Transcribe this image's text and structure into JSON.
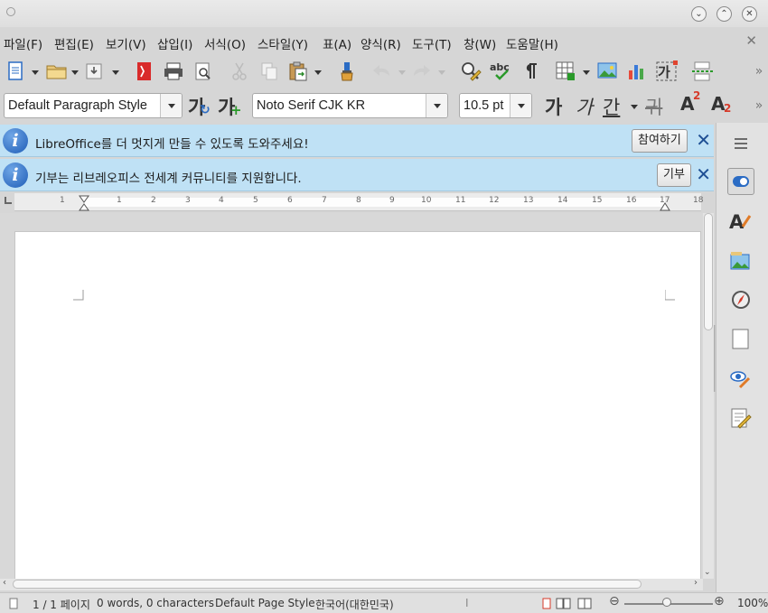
{
  "menubar": {
    "items": [
      "파일(F)",
      "편집(E)",
      "보기(V)",
      "삽입(I)",
      "서식(O)",
      "스타일(Y)",
      "표(A)",
      "양식(R)",
      "도구(T)",
      "창(W)",
      "도움말(H)"
    ]
  },
  "formatting": {
    "paragraph_style": "Default Paragraph Style",
    "font_name": "Noto Serif CJK KR",
    "font_size": "10.5 pt",
    "bold_glyph": "가",
    "italic_glyph": "가",
    "underline_glyph": "간",
    "strike_glyph": "귀",
    "new_style_glyph": "가",
    "update_style_glyph": "가",
    "superscript_glyph": "A",
    "superscript_mark": "2",
    "subscript_glyph": "A",
    "subscript_mark": "2",
    "char_glyph": "가"
  },
  "infobars": [
    {
      "message": "LibreOffice를 더 멋지게 만들 수 있도록 도와주세요!",
      "button": "참여하기"
    },
    {
      "message": "기부는 리브레오피스 전세계 커뮤니티를 지원합니다.",
      "button": "기부"
    }
  ],
  "ruler": {
    "numbers": [
      "1",
      "1",
      "2",
      "3",
      "4",
      "5",
      "6",
      "7",
      "8",
      "9",
      "10",
      "11",
      "12",
      "13",
      "14",
      "15",
      "16",
      "17",
      "18"
    ]
  },
  "statusbar": {
    "page": "1 / 1 페이지",
    "words": "0 words, 0 characters",
    "page_style": "Default Page Style",
    "language": "한국어(대한민국)",
    "zoom": "100%"
  },
  "colors": {
    "infobar_bg": "#bfe1f5",
    "info_icon": "#1f5db7",
    "close_x": "#1e4f94"
  }
}
